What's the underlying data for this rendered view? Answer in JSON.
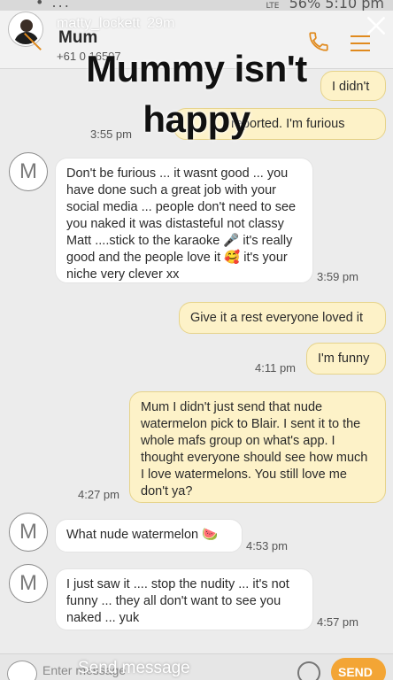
{
  "status": {
    "left": "• ...",
    "network": "LTE",
    "battery": "56%",
    "time": "5:10 pm"
  },
  "story": {
    "user": "matty_lockett",
    "age": "29m"
  },
  "contact": {
    "name": "Mum",
    "number": "+61 0     16597"
  },
  "caption": {
    "line1": "Mummy isn't",
    "line2": "happy"
  },
  "messages": [
    {
      "dir": "out",
      "text": "I didn't"
    },
    {
      "dir": "out",
      "text": "reported. I'm furious",
      "time": "3:55 pm"
    },
    {
      "dir": "in",
      "avatar": "M",
      "text": "Don't be furious ... it wasnt good ... you have done such a great job with your social media ... people don't need to see you naked it was distasteful not classy Matt ....stick to the karaoke 🎤 it's really good and the people love it 🥰 it's your niche very clever xx",
      "time": "3:59 pm"
    },
    {
      "dir": "out",
      "text": "Give it a rest everyone loved it"
    },
    {
      "dir": "out",
      "text": "I'm funny",
      "time": "4:11 pm"
    },
    {
      "dir": "out",
      "text": "Mum I didn't just send that nude watermelon pick to Blair. I sent it to the whole mafs group on what's app. I thought everyone should see how much I love watermelons. You still love me don't ya?",
      "time": "4:27 pm"
    },
    {
      "dir": "in",
      "avatar": "M",
      "text": "What nude watermelon 🍉",
      "time": "4:53 pm"
    },
    {
      "dir": "in",
      "avatar": "M",
      "text": "I just saw it .... stop the nudity ... it's not funny ... they all don't want to see you naked ... yuk",
      "time": "4:57 pm"
    }
  ],
  "input": {
    "placeholder": "Enter message",
    "overlay": "Send message",
    "send_label": "SEND"
  },
  "icons": {
    "phone": "phone-icon",
    "menu": "menu-icon",
    "close": "close-icon",
    "camera": "camera-icon",
    "emoji": "emoji-icon"
  },
  "colors": {
    "accent": "#e08a1e",
    "outgoing_bubble": "#fdf2c8",
    "incoming_bubble": "#ffffff",
    "send": "#f3a535"
  }
}
